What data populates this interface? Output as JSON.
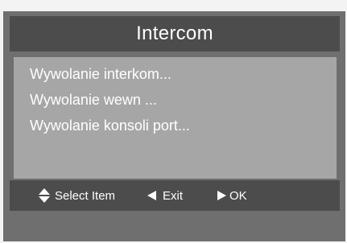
{
  "dialog": {
    "title": "Intercom"
  },
  "menu": {
    "items": [
      {
        "label": "Wywolanie interkom..."
      },
      {
        "label": "Wywolanie wewn ..."
      },
      {
        "label": "Wywolanie konsoli port..."
      }
    ]
  },
  "footer": {
    "select_label": "Select Item",
    "select_icon": "up-down-arrow-icon",
    "exit_label": "Exit",
    "exit_icon": "left-arrow-icon",
    "ok_label": "OK",
    "ok_icon": "right-arrow-icon"
  },
  "colors": {
    "frame": "#6f6f6f",
    "header": "#4c4c4c",
    "content": "#a6a6a6",
    "text": "#ffffff"
  }
}
